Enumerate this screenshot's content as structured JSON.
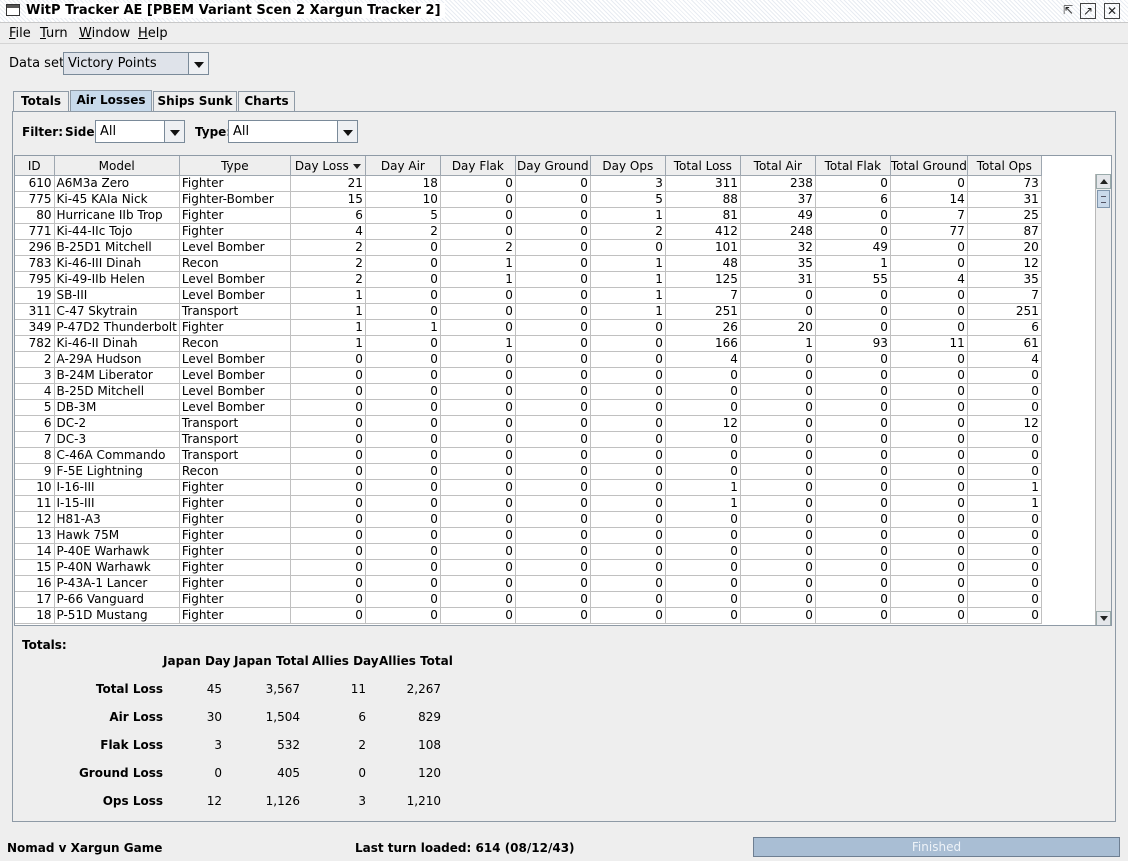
{
  "window": {
    "title": "WitP Tracker AE [PBEM Variant Scen 2 Xargun Tracker 2]",
    "min_glyph": "⇱",
    "max_glyph": "↗",
    "close_glyph": "✕"
  },
  "menu": [
    {
      "mnemonic": "F",
      "rest": "ile"
    },
    {
      "mnemonic": "T",
      "rest": "urn"
    },
    {
      "mnemonic": "W",
      "rest": "indow"
    },
    {
      "mnemonic": "H",
      "rest": "elp"
    }
  ],
  "dataset": {
    "label": "Data set:",
    "value": "Victory Points"
  },
  "tabs": [
    "Totals",
    "Air Losses",
    "Ships Sunk",
    "Charts"
  ],
  "active_tab": 1,
  "filter": {
    "label": "Filter:",
    "side_label": "Side:",
    "side_value": "All",
    "type_label": "Type:",
    "type_value": "All"
  },
  "table": {
    "columns": [
      "ID",
      "Model",
      "Type",
      "Day Loss",
      "Day Air",
      "Day Flak",
      "Day Ground",
      "Day Ops",
      "Total Loss",
      "Total Air",
      "Total Flak",
      "Total Ground",
      "Total Ops"
    ],
    "sorted_column": "Day Loss",
    "rows": [
      [
        "610",
        "A6M3a Zero",
        "Fighter",
        "21",
        "18",
        "0",
        "0",
        "3",
        "311",
        "238",
        "0",
        "0",
        "73"
      ],
      [
        "775",
        "Ki-45 KAIa Nick",
        "Fighter-Bomber",
        "15",
        "10",
        "0",
        "0",
        "5",
        "88",
        "37",
        "6",
        "14",
        "31"
      ],
      [
        "80",
        "Hurricane IIb Trop",
        "Fighter",
        "6",
        "5",
        "0",
        "0",
        "1",
        "81",
        "49",
        "0",
        "7",
        "25"
      ],
      [
        "771",
        "Ki-44-IIc Tojo",
        "Fighter",
        "4",
        "2",
        "0",
        "0",
        "2",
        "412",
        "248",
        "0",
        "77",
        "87"
      ],
      [
        "296",
        "B-25D1 Mitchell",
        "Level Bomber",
        "2",
        "0",
        "2",
        "0",
        "0",
        "101",
        "32",
        "49",
        "0",
        "20"
      ],
      [
        "783",
        "Ki-46-III Dinah",
        "Recon",
        "2",
        "0",
        "1",
        "0",
        "1",
        "48",
        "35",
        "1",
        "0",
        "12"
      ],
      [
        "795",
        "Ki-49-IIb Helen",
        "Level Bomber",
        "2",
        "0",
        "1",
        "0",
        "1",
        "125",
        "31",
        "55",
        "4",
        "35"
      ],
      [
        "19",
        "SB-III",
        "Level Bomber",
        "1",
        "0",
        "0",
        "0",
        "1",
        "7",
        "0",
        "0",
        "0",
        "7"
      ],
      [
        "311",
        "C-47 Skytrain",
        "Transport",
        "1",
        "0",
        "0",
        "0",
        "1",
        "251",
        "0",
        "0",
        "0",
        "251"
      ],
      [
        "349",
        "P-47D2 Thunderbolt",
        "Fighter",
        "1",
        "1",
        "0",
        "0",
        "0",
        "26",
        "20",
        "0",
        "0",
        "6"
      ],
      [
        "782",
        "Ki-46-II Dinah",
        "Recon",
        "1",
        "0",
        "1",
        "0",
        "0",
        "166",
        "1",
        "93",
        "11",
        "61"
      ],
      [
        "2",
        "A-29A Hudson",
        "Level Bomber",
        "0",
        "0",
        "0",
        "0",
        "0",
        "4",
        "0",
        "0",
        "0",
        "4"
      ],
      [
        "3",
        "B-24M Liberator",
        "Level Bomber",
        "0",
        "0",
        "0",
        "0",
        "0",
        "0",
        "0",
        "0",
        "0",
        "0"
      ],
      [
        "4",
        "B-25D Mitchell",
        "Level Bomber",
        "0",
        "0",
        "0",
        "0",
        "0",
        "0",
        "0",
        "0",
        "0",
        "0"
      ],
      [
        "5",
        "DB-3M",
        "Level Bomber",
        "0",
        "0",
        "0",
        "0",
        "0",
        "0",
        "0",
        "0",
        "0",
        "0"
      ],
      [
        "6",
        "DC-2",
        "Transport",
        "0",
        "0",
        "0",
        "0",
        "0",
        "12",
        "0",
        "0",
        "0",
        "12"
      ],
      [
        "7",
        "DC-3",
        "Transport",
        "0",
        "0",
        "0",
        "0",
        "0",
        "0",
        "0",
        "0",
        "0",
        "0"
      ],
      [
        "8",
        "C-46A Commando",
        "Transport",
        "0",
        "0",
        "0",
        "0",
        "0",
        "0",
        "0",
        "0",
        "0",
        "0"
      ],
      [
        "9",
        "F-5E Lightning",
        "Recon",
        "0",
        "0",
        "0",
        "0",
        "0",
        "0",
        "0",
        "0",
        "0",
        "0"
      ],
      [
        "10",
        "I-16-III",
        "Fighter",
        "0",
        "0",
        "0",
        "0",
        "0",
        "1",
        "0",
        "0",
        "0",
        "1"
      ],
      [
        "11",
        "I-15-III",
        "Fighter",
        "0",
        "0",
        "0",
        "0",
        "0",
        "1",
        "0",
        "0",
        "0",
        "1"
      ],
      [
        "12",
        "H81-A3",
        "Fighter",
        "0",
        "0",
        "0",
        "0",
        "0",
        "0",
        "0",
        "0",
        "0",
        "0"
      ],
      [
        "13",
        "Hawk 75M",
        "Fighter",
        "0",
        "0",
        "0",
        "0",
        "0",
        "0",
        "0",
        "0",
        "0",
        "0"
      ],
      [
        "14",
        "P-40E Warhawk",
        "Fighter",
        "0",
        "0",
        "0",
        "0",
        "0",
        "0",
        "0",
        "0",
        "0",
        "0"
      ],
      [
        "15",
        "P-40N Warhawk",
        "Fighter",
        "0",
        "0",
        "0",
        "0",
        "0",
        "0",
        "0",
        "0",
        "0",
        "0"
      ],
      [
        "16",
        "P-43A-1 Lancer",
        "Fighter",
        "0",
        "0",
        "0",
        "0",
        "0",
        "0",
        "0",
        "0",
        "0",
        "0"
      ],
      [
        "17",
        "P-66 Vanguard",
        "Fighter",
        "0",
        "0",
        "0",
        "0",
        "0",
        "0",
        "0",
        "0",
        "0",
        "0"
      ],
      [
        "18",
        "P-51D Mustang",
        "Fighter",
        "0",
        "0",
        "0",
        "0",
        "0",
        "0",
        "0",
        "0",
        "0",
        "0"
      ]
    ]
  },
  "totals": {
    "title": "Totals:",
    "headers": [
      "Japan Day",
      "Japan Total",
      "Allies Day",
      "Allies Total"
    ],
    "rows": [
      {
        "label": "Total Loss",
        "values": [
          "45",
          "3,567",
          "11",
          "2,267"
        ]
      },
      {
        "label": "Air Loss",
        "values": [
          "30",
          "1,504",
          "6",
          "829"
        ]
      },
      {
        "label": "Flak Loss",
        "values": [
          "3",
          "532",
          "2",
          "108"
        ]
      },
      {
        "label": "Ground Loss",
        "values": [
          "0",
          "405",
          "0",
          "120"
        ]
      },
      {
        "label": "Ops Loss",
        "values": [
          "12",
          "1,126",
          "3",
          "1,210"
        ]
      }
    ]
  },
  "status": {
    "game": "Nomad v Xargun Game",
    "last_turn": "Last turn loaded: 614 (08/12/43)",
    "progress_label": "Finished",
    "progress_fraction": 1.0
  }
}
